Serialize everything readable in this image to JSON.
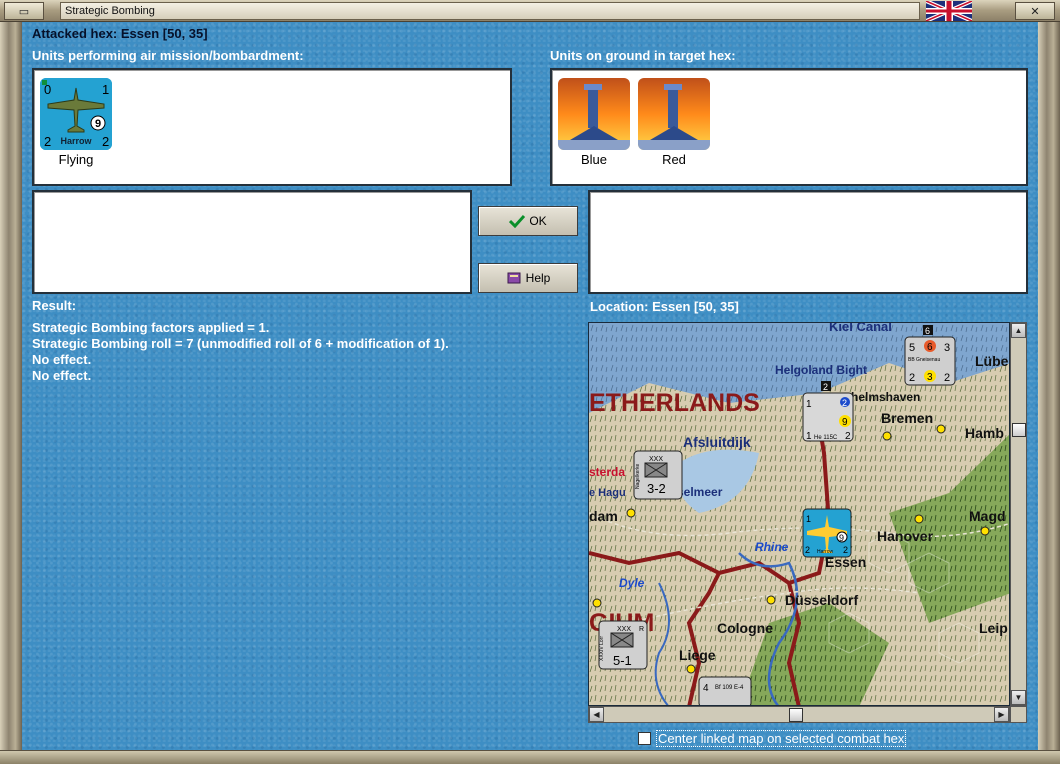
{
  "window": {
    "title": "Strategic Bombing",
    "close_glyph": "✕",
    "minimize_glyph": "▭"
  },
  "header": {
    "attacked_hex": "Attacked hex: Essen  [50, 35]"
  },
  "air_units": {
    "label": "Units performing air mission/bombardment:",
    "items": [
      {
        "name": "Harrow",
        "caption": "Flying",
        "tl": "0",
        "tr": "1",
        "bl": "2",
        "br": "2",
        "range": "9"
      }
    ]
  },
  "ground_units": {
    "label": "Units on ground in target hex:",
    "items": [
      {
        "caption": "Blue"
      },
      {
        "caption": "Red"
      }
    ]
  },
  "buttons": {
    "ok": "OK",
    "help": "Help"
  },
  "result": {
    "label": "Result:",
    "lines": [
      "Strategic Bombing factors applied = 1.",
      "Strategic Bombing roll = 7 (unmodified roll of 6 + modification of 1).",
      "No effect.",
      "No effect."
    ]
  },
  "location": {
    "label": "Location:  Essen  [50, 35]"
  },
  "map": {
    "places": [
      "Kiel Canal",
      "Helgoland Bight",
      "Lübe",
      "helmshaven",
      "ETHERLANDS",
      "Bremen",
      "Hamb",
      "Afsluitdijk",
      "sterda",
      "e Hagu",
      "selmeer",
      "dam",
      "Magd",
      "Hanover",
      "Rhine",
      "Essen",
      "Dyle",
      "Düsseldorf",
      "GIUM",
      "Cologne",
      "Liege",
      "Leip"
    ],
    "counters": [
      {
        "name": "BB Gneisenau",
        "a": "5",
        "b": "6",
        "c": "3",
        "d": "2",
        "e": "3",
        "f": "2"
      },
      {
        "name": "He 115C",
        "a": "1",
        "b": "2",
        "c": "9",
        "d": "1",
        "e": "2"
      },
      {
        "name": "Nagelkerke",
        "corps": "XXX",
        "val": "3-2"
      },
      {
        "name": "Harrow",
        "a": "1",
        "b": "9",
        "c": "2",
        "d": "2"
      },
      {
        "name": "XXXIV Lorr",
        "corps": "XXX",
        "val": "5-1",
        "r": "R"
      },
      {
        "name": "Bf 109 E-4",
        "a": "4"
      }
    ],
    "counter_flag": "2",
    "counter_flag_top": "6"
  },
  "checkbox": {
    "label": "Center linked map on selected combat hex",
    "checked": false
  },
  "colors": {
    "panel": "#3e8ec4",
    "accent": "#0a8f2a",
    "border": "#8e8470"
  }
}
